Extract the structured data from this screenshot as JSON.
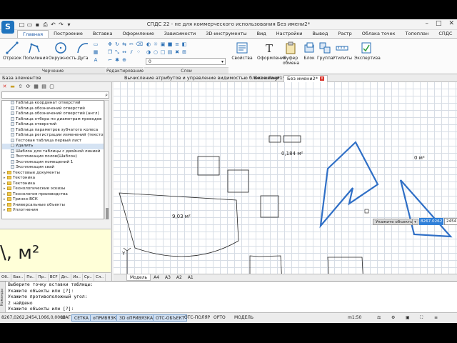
{
  "app": {
    "title": "СПДС 22 - не для коммерческого использования Без имени2*",
    "logo": "S"
  },
  "quick_access": [
    "new-icon",
    "open-icon",
    "save-icon",
    "print-icon",
    "undo-icon",
    "redo-icon",
    "settings-icon"
  ],
  "ribbon_tabs": [
    "Главная",
    "Построение",
    "Вставка",
    "Оформление",
    "Зависимости",
    "3D-инструменты",
    "Вид",
    "Настройки",
    "Вывод",
    "Растр",
    "Облака точек",
    "Топоплан",
    "СПДС"
  ],
  "active_tab": "Главная",
  "ribbon": {
    "draw": {
      "otrezok": "Отрезок",
      "polyline": "Полилиния",
      "circle": "Окружность",
      "arc": "Дуга"
    },
    "props": {
      "svoistva": "Свойства",
      "oformlenie": "Оформление",
      "bufer": "Буфер обмена",
      "blok": "Блок",
      "gruppa": "Группа",
      "utility": "Утилиты",
      "expertiza": "Экспертиза"
    },
    "groups": {
      "drawing": "Черчение",
      "editing": "Редактирование",
      "layers": "Слои"
    }
  },
  "layer_dropdown": "0",
  "doc_tabs": {
    "panel_title": "База элементов",
    "tabs": [
      "Вычисление атрибутов и управление видимостью блоков.dwg*",
      "Без имени1*",
      "Без имени2*"
    ],
    "active": 2
  },
  "tree": [
    {
      "label": "Таблица координат отверстий",
      "type": "table"
    },
    {
      "label": "Таблица обозначений отверстий",
      "type": "table"
    },
    {
      "label": "Таблица обозначений отверстий (англ)",
      "type": "table"
    },
    {
      "label": "Таблица отбора по диаметрам проводов",
      "type": "table"
    },
    {
      "label": "Таблица отверстий",
      "type": "table"
    },
    {
      "label": "Таблица параметров зубчатого колеса",
      "type": "table"
    },
    {
      "label": "Таблица регистрации изменений (текстов.",
      "type": "table"
    },
    {
      "label": "Тестовая таблица первый лист",
      "type": "table"
    },
    {
      "label": "Удалить",
      "type": "table",
      "selected": true
    },
    {
      "label": "Шаблон для таблицы с двойной линией",
      "type": "table"
    },
    {
      "label": "Экспликация полов(Шаблон)",
      "type": "table"
    },
    {
      "label": "Экспликация помещений 1",
      "type": "table"
    },
    {
      "label": "Экспликация свай",
      "type": "table"
    },
    {
      "label": "Текстовые документы",
      "type": "folder"
    },
    {
      "label": "Тектоника",
      "type": "folder"
    },
    {
      "label": "Тектоника",
      "type": "folder"
    },
    {
      "label": "Технологические эскизы",
      "type": "folder"
    },
    {
      "label": "Технология производства",
      "type": "folder"
    },
    {
      "label": "Тринко-ВСК",
      "type": "folder"
    },
    {
      "label": "Универсальные объекты",
      "type": "folder"
    },
    {
      "label": "Уплотнения",
      "type": "folder"
    }
  ],
  "preview_text": "\\, м²",
  "panel_tabs": [
    "Об..",
    "Баз..",
    "По..",
    "Пр..",
    "BCF",
    "Дн..",
    "Из..",
    "Ср..",
    "Сл.."
  ],
  "drawing": {
    "labels": [
      "9,03 м²",
      "0,184 м²",
      "0 м²"
    ]
  },
  "floating_input": {
    "prompt": "Укажите объекты",
    "x": "8267.0262",
    "y": "2454"
  },
  "layout_tabs": [
    "Модель",
    "A4",
    "A3",
    "A2",
    "A1"
  ],
  "active_layout": "Модель",
  "command_lines": [
    "Выберите точку вставки таблицы:",
    "Укажите объекты или [?]:",
    "Укажите противоположный угол:",
    "  2 найдено",
    "Укажите объекты или [?]:"
  ],
  "command_side_label": "Команды",
  "status": {
    "coords": "8267,0262,2454,1066,0,0000",
    "toggles": [
      "ШАГ",
      "СЕТКА",
      "оПРИВЯЗКА",
      "3D оПРИВЯЗКА",
      "ОТС-ОБЪЕКТ",
      "ОТС-ПОЛЯР",
      "ОРТО",
      "МОДЕЛЬ"
    ],
    "active_toggles": [
      "СЕТКА",
      "оПРИВЯЗКА",
      "3D оПРИВЯЗКА",
      "ОТС-ОБЪЕКТ"
    ],
    "scale": "m1:50"
  },
  "colors": {
    "accent": "#1e73be",
    "selection": "#2f6fc6",
    "grid": "#d7dde5"
  }
}
